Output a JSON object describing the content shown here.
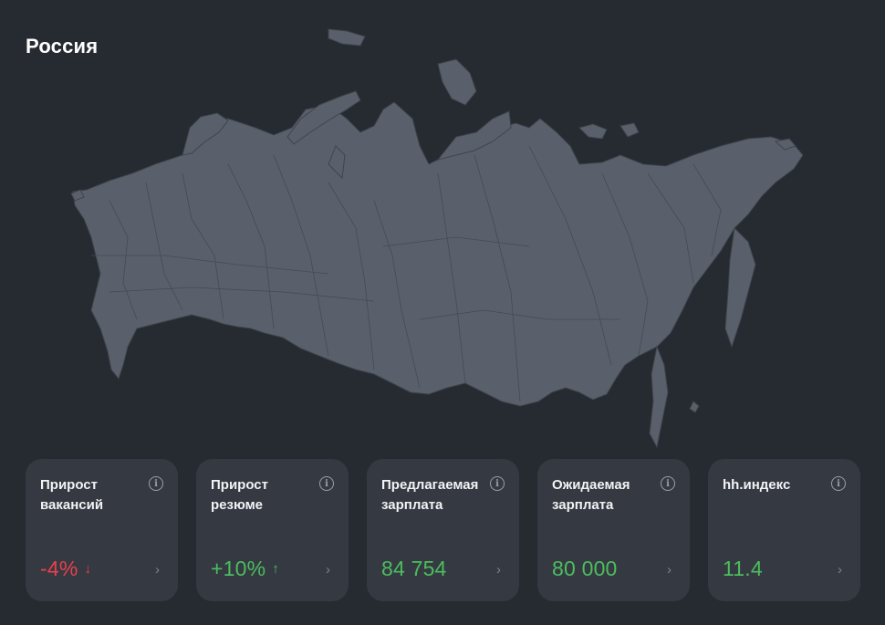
{
  "title": "Россия",
  "colors": {
    "background": "#262a31",
    "card": "#353a42",
    "map_fill": "#5a606b",
    "negative": "#e8404c",
    "positive": "#4cbd5e"
  },
  "cards": [
    {
      "label": "Прирост вакансий",
      "value": "-4%",
      "trend_icon": "arrow-down-icon",
      "trend": "↓"
    },
    {
      "label": "Прирост резюме",
      "value": "+10%",
      "trend_icon": "arrow-up-icon",
      "trend": "↑"
    },
    {
      "label": "Предлагаемая зарплата",
      "value": "84 754"
    },
    {
      "label": "Ожидаемая зарплата",
      "value": "80 000"
    },
    {
      "label": "hh.индекс",
      "value": "11.4"
    }
  ]
}
